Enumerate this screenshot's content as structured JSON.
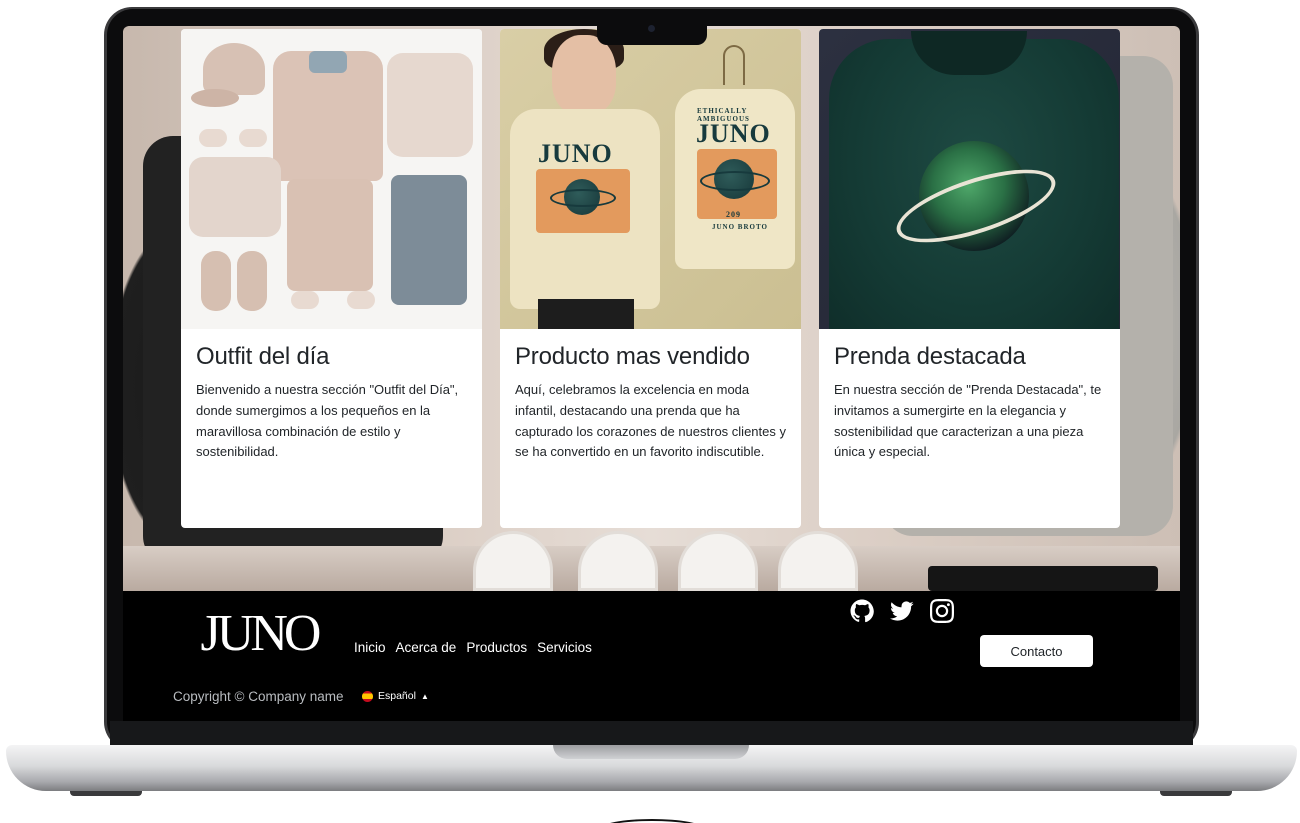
{
  "cards": [
    {
      "title": "Outfit del día",
      "text": "Bienvenido a nuestra sección \"Outfit del Día\", donde sumergimos a los pequeños en la maravillosa combinación de estilo y sostenibilidad."
    },
    {
      "title": "Producto mas vendido",
      "text": "Aquí, celebramos la excelencia en moda infantil, destacando una prenda que ha capturado los corazones de nuestros clientes y se ha convertido en un favorito indiscutible.",
      "image_text": {
        "left_brand": "JUNO",
        "right_top": "ETHICALLY AMBIGUOUS",
        "right_brand": "JUNO",
        "right_number": "209",
        "right_bottom": "JUNO BROTO"
      }
    },
    {
      "title": "Prenda destacada",
      "text": "En nuestra sección de \"Prenda Destacada\", te invitamos a sumergirte en la elegancia y sostenibilidad que caracterizan a una pieza única y especial."
    }
  ],
  "footer": {
    "logo_text": "JUNO",
    "nav": [
      "Inicio",
      "Acerca de",
      "Productos",
      "Servicios"
    ],
    "social_icons": [
      "github-icon",
      "twitter-icon",
      "instagram-icon"
    ],
    "contact_label": "Contacto",
    "copyright": "Copyright © Company name",
    "language": "Español"
  },
  "colors": {
    "footer_bg": "#000000",
    "card_bg": "#ffffff",
    "text": "#212529"
  }
}
